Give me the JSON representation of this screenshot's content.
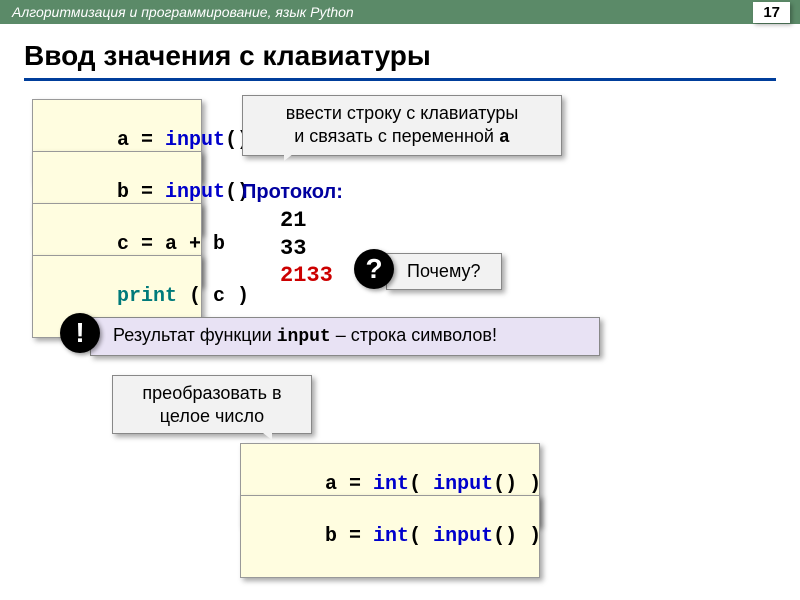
{
  "header": {
    "breadcrumb": "Алгоритмизация и программирование, язык Python",
    "page": "17"
  },
  "title": "Ввод значения с клавиатуры",
  "code": {
    "line1_a": "a",
    "line1_eq": " = ",
    "line1_fn": "input",
    "line1_paren": "()",
    "line2_a": "b",
    "line2_fn": "input",
    "line2_paren": "()",
    "line3": "c = a + b",
    "line4_fn": "print",
    "line4_rest": " ( c )",
    "int1_a": "a",
    "int1_int": "int",
    "int1_open": "( ",
    "int1_input": "input",
    "int1_par": "()",
    "int1_close": " )",
    "int2_a": "b",
    "int2_int": "int"
  },
  "callouts": {
    "enter_line1": "ввести строку с клавиатуры",
    "enter_line2_a": "и связать с переменной ",
    "enter_line2_b": "a",
    "why": "Почему?",
    "result_pre": "Результат функции ",
    "result_fn": "input",
    "result_post": " – строка символов!",
    "convert_l1": "преобразовать в",
    "convert_l2": "целое число"
  },
  "protocol": {
    "label": "Протокол:",
    "v1": "21",
    "v2": "33",
    "v3": "2133"
  },
  "badges": {
    "question": "?",
    "bang": "!"
  }
}
